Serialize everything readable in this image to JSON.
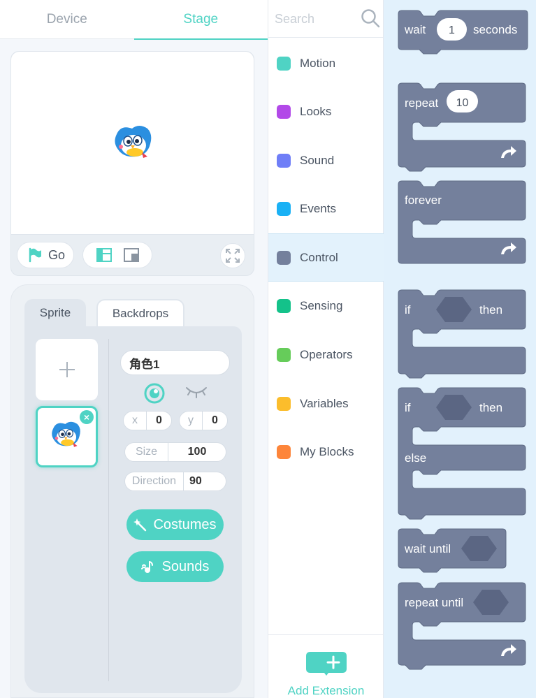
{
  "tabs": {
    "device": "Device",
    "stage": "Stage"
  },
  "stage_controls": {
    "go_label": "Go"
  },
  "sprite_panel": {
    "tab_sprite": "Sprite",
    "tab_backdrops": "Backdrops",
    "sprite_name": "角色1",
    "x_label": "x",
    "x_value": "0",
    "y_label": "y",
    "y_value": "0",
    "size_label": "Size",
    "size_value": "100",
    "direction_label": "Direction",
    "direction_value": "90",
    "costumes_label": "Costumes",
    "sounds_label": "Sounds"
  },
  "search": {
    "placeholder": "Search"
  },
  "categories": [
    {
      "label": "Motion",
      "color": "#4fd3c4"
    },
    {
      "label": "Looks",
      "color": "#b249e8"
    },
    {
      "label": "Sound",
      "color": "#6f7ef7"
    },
    {
      "label": "Events",
      "color": "#1ab1f5"
    },
    {
      "label": "Control",
      "color": "#74809c",
      "active": true
    },
    {
      "label": "Sensing",
      "color": "#14c28a"
    },
    {
      "label": "Operators",
      "color": "#66cc5a"
    },
    {
      "label": "Variables",
      "color": "#fbbd2c"
    },
    {
      "label": "My Blocks",
      "color": "#fd853a"
    }
  ],
  "add_extension": "Add Extension",
  "blocks": {
    "color": "#74809c",
    "wait_pre": "wait",
    "wait_value": "1",
    "wait_post": "seconds",
    "repeat_label": "repeat",
    "repeat_value": "10",
    "forever_label": "forever",
    "if_label": "if",
    "then_label": "then",
    "if2_label": "if",
    "then2_label": "then",
    "else_label": "else",
    "wait_until_label": "wait until",
    "repeat_until_label": "repeat until"
  }
}
